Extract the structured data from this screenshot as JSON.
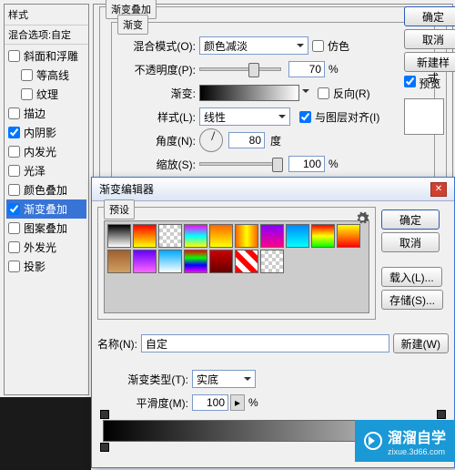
{
  "styles": {
    "title": "样式",
    "subtitle": "混合选项:自定",
    "items": [
      {
        "label": "斜面和浮雕",
        "checked": false,
        "sel": false
      },
      {
        "label": "等高线",
        "checked": false,
        "sel": false,
        "indent": true
      },
      {
        "label": "纹理",
        "checked": false,
        "sel": false,
        "indent": true
      },
      {
        "label": "描边",
        "checked": false,
        "sel": false
      },
      {
        "label": "内阴影",
        "checked": true,
        "sel": false
      },
      {
        "label": "内发光",
        "checked": false,
        "sel": false
      },
      {
        "label": "光泽",
        "checked": false,
        "sel": false
      },
      {
        "label": "颜色叠加",
        "checked": false,
        "sel": false
      },
      {
        "label": "渐变叠加",
        "checked": true,
        "sel": true
      },
      {
        "label": "图案叠加",
        "checked": false,
        "sel": false
      },
      {
        "label": "外发光",
        "checked": false,
        "sel": false
      },
      {
        "label": "投影",
        "checked": false,
        "sel": false
      }
    ]
  },
  "main": {
    "group_title": "渐变叠加",
    "inner_title": "渐变",
    "blend_label": "混合模式(O):",
    "blend_value": "颜色减淡",
    "dither_label": "仿色",
    "opacity_label": "不透明度(P):",
    "opacity_value": "70",
    "pct": "%",
    "gradient_label": "渐变:",
    "reverse_label": "反向(R)",
    "shape_label": "样式(L):",
    "shape_value": "线性",
    "align_label": "与图层对齐(I)",
    "angle_label": "角度(N):",
    "angle_value": "80",
    "deg": "度",
    "scale_label": "缩放(S):",
    "scale_value": "100"
  },
  "buttons": {
    "ok": "确定",
    "cancel": "取消",
    "newstyle": "新建样式",
    "preview": "预览"
  },
  "editor": {
    "title": "渐变编辑器",
    "presets_label": "预设",
    "ok": "确定",
    "cancel": "取消",
    "load": "载入(L)...",
    "save": "存储(S)...",
    "name_label": "名称(N):",
    "name_value": "自定",
    "new_btn": "新建(W)",
    "type_label": "渐变类型(T):",
    "type_value": "实底",
    "smooth_label": "平滑度(M):",
    "smooth_value": "100",
    "pct": "%",
    "swatches": [
      [
        "linear-gradient(#000,#fff)",
        "linear-gradient(#f00,#ff0)",
        "repeating-conic-gradient(#ccc 0 25%,#fff 0 50%) 0/8px 8px",
        "linear-gradient(#f0f,#0ff,#ff0)",
        "linear-gradient(#f60,#ff0)",
        "linear-gradient(90deg,#f60,#ff0,#f60)",
        "linear-gradient(#80f,#f08)",
        "linear-gradient(#08f,#0ff)",
        "linear-gradient(#f00,#ff0,#0f0)",
        "linear-gradient(#ff0,#f00)"
      ],
      [
        "linear-gradient(#a06030,#d0a060)",
        "linear-gradient(#60f,#f6f)",
        "linear-gradient(#0af,#fff)",
        "linear-gradient(#f00,#0f0,#00f,#f0f)",
        "linear-gradient(#c00,#600)",
        "repeating-linear-gradient(45deg,#f00 0 6px,#fff 0 12px)",
        "repeating-conic-gradient(#ccc 0 25%,#fff 0 50%) 0/8px 8px",
        "",
        "",
        ""
      ]
    ]
  },
  "watermark": {
    "brand": "溜溜自学",
    "url": "zixue.3d66.com"
  }
}
